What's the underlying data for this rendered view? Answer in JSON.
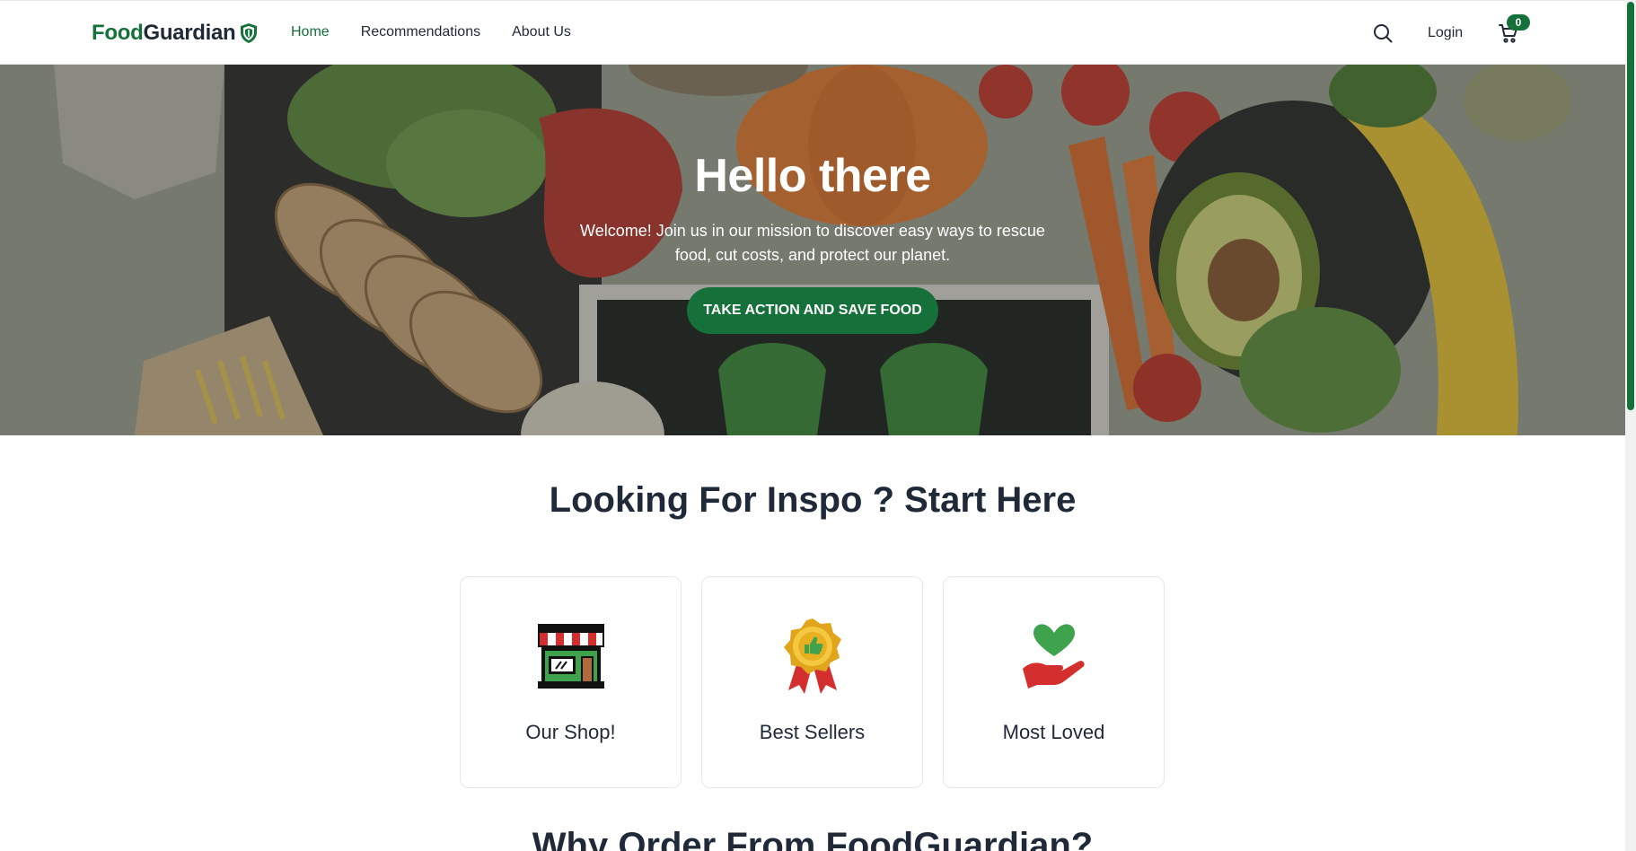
{
  "brand": {
    "part1": "Food",
    "part2": "Guardian"
  },
  "nav": {
    "links": [
      {
        "label": "Home",
        "active": true
      },
      {
        "label": "Recommendations",
        "active": false
      },
      {
        "label": "About Us",
        "active": false
      }
    ],
    "login_label": "Login",
    "cart_count": "0"
  },
  "hero": {
    "title": "Hello there",
    "subtitle": "Welcome! Join us in our mission to discover easy ways to rescue food, cut costs, and protect our planet.",
    "cta_label": "TAKE ACTION AND SAVE FOOD"
  },
  "inspo": {
    "title": "Looking For Inspo ? Start Here",
    "cards": [
      {
        "label": "Our Shop!",
        "icon": "shop-icon"
      },
      {
        "label": "Best Sellers",
        "icon": "award-medal-icon"
      },
      {
        "label": "Most Loved",
        "icon": "heart-hand-icon"
      }
    ]
  },
  "why": {
    "title": "Why Order From FoodGuardian?"
  },
  "colors": {
    "brand_green": "#15703a",
    "text_dark": "#1f2937"
  }
}
